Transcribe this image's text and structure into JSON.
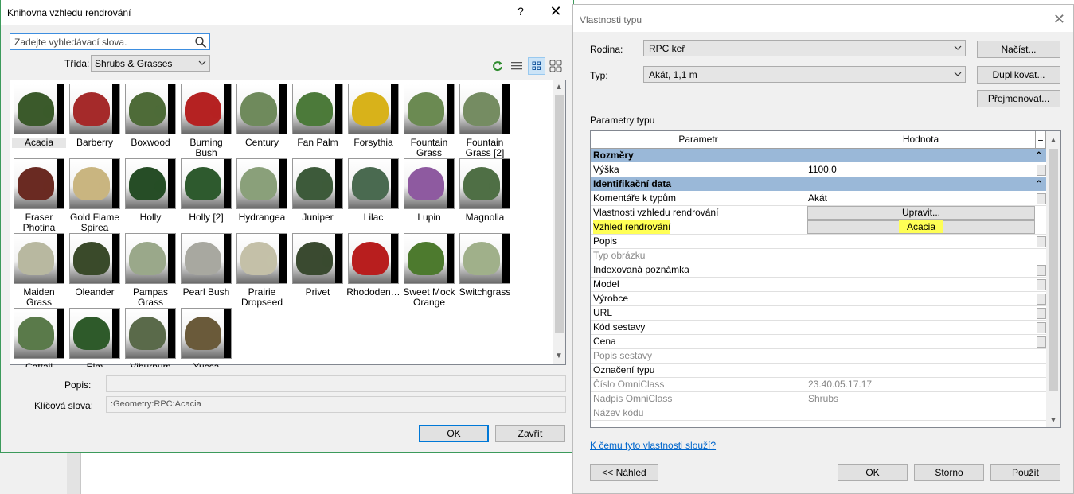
{
  "library": {
    "title": "Knihovna vzhledu rendrování",
    "help_label": "?",
    "close_label": "✕",
    "search_placeholder": "Zadejte vyhledávací slova.",
    "class_label": "Třída:",
    "class_value": "Shrubs & Grasses",
    "assets": [
      {
        "name": "Acacia",
        "color": "#3b5a2b"
      },
      {
        "name": "Barberry",
        "color": "#a52a2a"
      },
      {
        "name": "Boxwood",
        "color": "#4e6b38"
      },
      {
        "name": "Burning Bush",
        "color": "#b52222"
      },
      {
        "name": "Century",
        "color": "#6f8a5c"
      },
      {
        "name": "Fan Palm",
        "color": "#4c7a3a"
      },
      {
        "name": "Forsythia",
        "color": "#d8b21a"
      },
      {
        "name": "Fountain Grass",
        "color": "#6b8a52"
      },
      {
        "name": "Fountain Grass [2]",
        "color": "#758c62"
      },
      {
        "name": "Fraser Photina",
        "color": "#6a2a22"
      },
      {
        "name": "Gold Flame Spirea",
        "color": "#c9b580"
      },
      {
        "name": "Holly",
        "color": "#264d26"
      },
      {
        "name": "Holly [2]",
        "color": "#2e5a2e"
      },
      {
        "name": "Hydrangea",
        "color": "#8aa07a"
      },
      {
        "name": "Juniper",
        "color": "#3d5a3a"
      },
      {
        "name": "Lilac",
        "color": "#4a6a50"
      },
      {
        "name": "Lupin",
        "color": "#8e5aa0"
      },
      {
        "name": "Magnolia",
        "color": "#4f6f45"
      },
      {
        "name": "Maiden Grass",
        "color": "#b8b8a0"
      },
      {
        "name": "Oleander",
        "color": "#3a4a2a"
      },
      {
        "name": "Pampas Grass",
        "color": "#9aa88a"
      },
      {
        "name": "Pearl Bush",
        "color": "#a8a8a0"
      },
      {
        "name": "Prairie Dropseed",
        "color": "#c4c0a8"
      },
      {
        "name": "Privet",
        "color": "#3a4a30"
      },
      {
        "name": "Rhododen…",
        "color": "#b81e1e"
      },
      {
        "name": "Sweet Mock Orange",
        "color": "#4d7a2e"
      },
      {
        "name": "Switchgrass",
        "color": "#a0b08a"
      },
      {
        "name": "Cattail",
        "color": "#5a7a4a"
      },
      {
        "name": "Elm",
        "color": "#2e5a2a"
      },
      {
        "name": "Viburnum",
        "color": "#5a6a4a"
      },
      {
        "name": "Yucca",
        "color": "#6a5a3a"
      }
    ],
    "popis_label": "Popis:",
    "popis_value": "",
    "keywords_label": "Klíčová slova:",
    "keywords_value": ":Geometry:RPC:Acacia",
    "ok_label": "OK",
    "cancel_label": "Zavřít"
  },
  "props": {
    "title": "Vlastnosti typu",
    "close_label": "✕",
    "family_label": "Rodina:",
    "family_value": "RPC keř",
    "type_label": "Typ:",
    "type_value": "Akát, 1,1 m",
    "load_label": "Načíst...",
    "duplicate_label": "Duplikovat...",
    "rename_label": "Přejmenovat...",
    "params_caption": "Parametry typu",
    "col_param": "Parametr",
    "col_value": "Hodnota",
    "col_eq": "=",
    "rows": [
      {
        "group": true,
        "param": "Rozměry",
        "value": ""
      },
      {
        "param": "Výška",
        "value": "1100,0",
        "mini": true
      },
      {
        "group": true,
        "param": "Identifikační data",
        "value": ""
      },
      {
        "param": "Komentáře k typům",
        "value": "Akát",
        "mini": true
      },
      {
        "param": "Vlastnosti vzhledu rendrování",
        "value": "Upravit...",
        "button": true
      },
      {
        "param": "Vzhled rendrování",
        "value": "Acacia",
        "button": true,
        "highlight": true
      },
      {
        "param": "Popis",
        "value": "",
        "mini": true
      },
      {
        "param": "Typ obrázku",
        "value": "",
        "gray": true
      },
      {
        "param": "Indexovaná poznámka",
        "value": "",
        "mini": true
      },
      {
        "param": "Model",
        "value": "",
        "mini": true
      },
      {
        "param": "Výrobce",
        "value": "",
        "mini": true
      },
      {
        "param": "URL",
        "value": "",
        "mini": true
      },
      {
        "param": "Kód sestavy",
        "value": "",
        "mini": true
      },
      {
        "param": "Cena",
        "value": "",
        "mini": true
      },
      {
        "param": "Popis sestavy",
        "value": "",
        "gray": true
      },
      {
        "param": "Označení typu",
        "value": ""
      },
      {
        "param": "Číslo OmniClass",
        "value": "23.40.05.17.17",
        "gray": true
      },
      {
        "param": "Nadpis OmniClass",
        "value": "Shrubs",
        "gray": true
      },
      {
        "param": "Název kódu",
        "value": "",
        "gray": true
      }
    ],
    "help_link": "K čemu tyto vlastnosti slouží?",
    "preview_label": "<< Náhled",
    "ok_label": "OK",
    "cancel_label": "Storno",
    "apply_label": "Použít"
  }
}
